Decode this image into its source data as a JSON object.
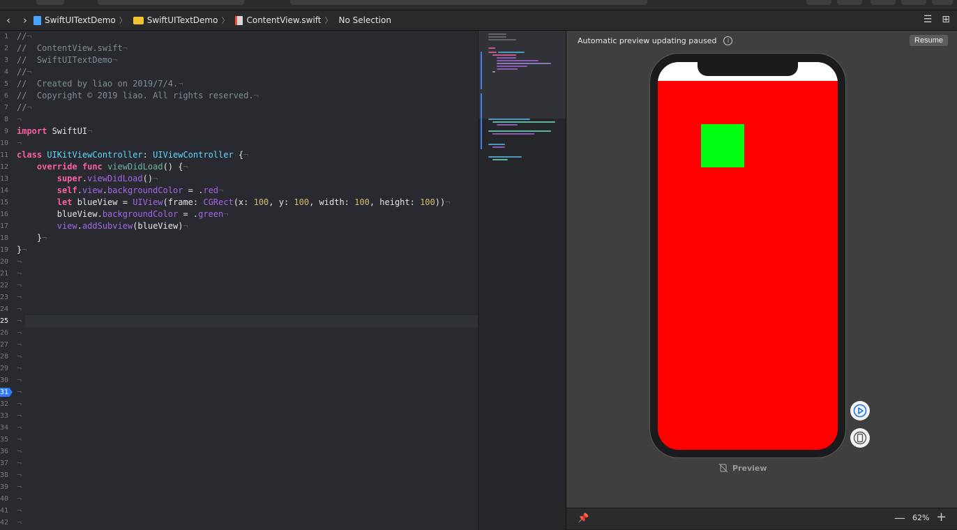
{
  "jumpbar": {
    "crumbs": [
      {
        "label": "SwiftUITextDemo",
        "icon": "swift-project-icon"
      },
      {
        "label": "SwiftUITextDemo",
        "icon": "folder-icon"
      },
      {
        "label": "ContentView.swift",
        "icon": "swift-file-icon"
      },
      {
        "label": "No Selection",
        "icon": ""
      }
    ]
  },
  "editor": {
    "current_line": 25,
    "breakpoint_line": 31,
    "line_count": 42
  },
  "code_lines": [
    [
      {
        "t": "//",
        "c": "com"
      },
      {
        "t": "¬",
        "c": "sp"
      }
    ],
    [
      {
        "t": "//  ContentView.swift",
        "c": "com"
      },
      {
        "t": "¬",
        "c": "sp"
      }
    ],
    [
      {
        "t": "//  SwiftUITextDemo",
        "c": "com"
      },
      {
        "t": "¬",
        "c": "sp"
      }
    ],
    [
      {
        "t": "//",
        "c": "com"
      },
      {
        "t": "¬",
        "c": "sp"
      }
    ],
    [
      {
        "t": "//  Created by liao on 2019/7/4.",
        "c": "com"
      },
      {
        "t": "¬",
        "c": "sp"
      }
    ],
    [
      {
        "t": "//  Copyright © 2019 liao. All rights reserved.",
        "c": "com"
      },
      {
        "t": "¬",
        "c": "sp"
      }
    ],
    [
      {
        "t": "//",
        "c": "com"
      },
      {
        "t": "¬",
        "c": "sp"
      }
    ],
    [
      {
        "t": "¬",
        "c": "sp"
      }
    ],
    [
      {
        "t": "import",
        "c": "kw"
      },
      {
        "t": " SwiftUI",
        "c": "plain"
      },
      {
        "t": "¬",
        "c": "sp"
      }
    ],
    [
      {
        "t": "¬",
        "c": "sp"
      }
    ],
    [
      {
        "t": "class",
        "c": "kw"
      },
      {
        "t": " ",
        "c": "plain"
      },
      {
        "t": "UIKitViewController",
        "c": "type"
      },
      {
        "t": ": ",
        "c": "plain"
      },
      {
        "t": "UIViewController",
        "c": "type"
      },
      {
        "t": " {",
        "c": "plain"
      },
      {
        "t": "¬",
        "c": "sp"
      }
    ],
    [
      {
        "t": "    ",
        "c": "plain"
      },
      {
        "t": "override",
        "c": "kw"
      },
      {
        "t": " ",
        "c": "plain"
      },
      {
        "t": "func",
        "c": "kw"
      },
      {
        "t": " ",
        "c": "plain"
      },
      {
        "t": "viewDidLoad",
        "c": "fn"
      },
      {
        "t": "() {",
        "c": "plain"
      },
      {
        "t": "¬",
        "c": "sp"
      }
    ],
    [
      {
        "t": "        ",
        "c": "plain"
      },
      {
        "t": "super",
        "c": "kw"
      },
      {
        "t": ".",
        "c": "plain"
      },
      {
        "t": "viewDidLoad",
        "c": "prop"
      },
      {
        "t": "()",
        "c": "plain"
      },
      {
        "t": "¬",
        "c": "sp"
      }
    ],
    [
      {
        "t": "        ",
        "c": "plain"
      },
      {
        "t": "self",
        "c": "kw"
      },
      {
        "t": ".",
        "c": "plain"
      },
      {
        "t": "view",
        "c": "prop"
      },
      {
        "t": ".",
        "c": "plain"
      },
      {
        "t": "backgroundColor",
        "c": "prop"
      },
      {
        "t": " = .",
        "c": "plain"
      },
      {
        "t": "red",
        "c": "prop"
      },
      {
        "t": "¬",
        "c": "sp"
      }
    ],
    [
      {
        "t": "        ",
        "c": "plain"
      },
      {
        "t": "let",
        "c": "kw"
      },
      {
        "t": " blueView = ",
        "c": "plain"
      },
      {
        "t": "UIView",
        "c": "prop"
      },
      {
        "t": "(frame: ",
        "c": "plain"
      },
      {
        "t": "CGRect",
        "c": "prop"
      },
      {
        "t": "(x: ",
        "c": "plain"
      },
      {
        "t": "100",
        "c": "num"
      },
      {
        "t": ", y: ",
        "c": "plain"
      },
      {
        "t": "100",
        "c": "num"
      },
      {
        "t": ", width: ",
        "c": "plain"
      },
      {
        "t": "100",
        "c": "num"
      },
      {
        "t": ", height: ",
        "c": "plain"
      },
      {
        "t": "100",
        "c": "num"
      },
      {
        "t": "))",
        "c": "plain"
      },
      {
        "t": "¬",
        "c": "sp"
      }
    ],
    [
      {
        "t": "        blueView.",
        "c": "plain"
      },
      {
        "t": "backgroundColor",
        "c": "prop"
      },
      {
        "t": " = .",
        "c": "plain"
      },
      {
        "t": "green",
        "c": "prop"
      },
      {
        "t": "¬",
        "c": "sp"
      }
    ],
    [
      {
        "t": "        ",
        "c": "plain"
      },
      {
        "t": "view",
        "c": "prop"
      },
      {
        "t": ".",
        "c": "plain"
      },
      {
        "t": "addSubview",
        "c": "prop"
      },
      {
        "t": "(blueView)",
        "c": "plain"
      },
      {
        "t": "¬",
        "c": "sp"
      }
    ],
    [
      {
        "t": "    }",
        "c": "plain"
      },
      {
        "t": "¬",
        "c": "sp"
      }
    ],
    [
      {
        "t": "}",
        "c": "plain"
      },
      {
        "t": "¬",
        "c": "sp"
      }
    ],
    [
      {
        "t": "¬",
        "c": "sp"
      }
    ],
    [
      {
        "t": "¬",
        "c": "sp"
      }
    ],
    [
      {
        "t": "¬",
        "c": "sp"
      }
    ],
    [
      {
        "t": "¬",
        "c": "sp"
      }
    ],
    [
      {
        "t": "¬",
        "c": "sp"
      }
    ],
    [
      {
        "t": "¬",
        "c": "sp"
      }
    ],
    [
      {
        "t": "¬",
        "c": "sp"
      }
    ],
    [
      {
        "t": "¬",
        "c": "sp"
      }
    ],
    [
      {
        "t": "¬",
        "c": "sp"
      }
    ],
    [
      {
        "t": "¬",
        "c": "sp"
      }
    ],
    [
      {
        "t": "¬",
        "c": "sp"
      }
    ],
    [
      {
        "t": "¬",
        "c": "sp"
      }
    ],
    [
      {
        "t": "¬",
        "c": "sp"
      }
    ],
    [
      {
        "t": "¬",
        "c": "sp"
      }
    ],
    [
      {
        "t": "¬",
        "c": "sp"
      }
    ],
    [
      {
        "t": "¬",
        "c": "sp"
      }
    ],
    [
      {
        "t": "¬",
        "c": "sp"
      }
    ],
    [
      {
        "t": "¬",
        "c": "sp"
      }
    ],
    [
      {
        "t": "¬",
        "c": "sp"
      }
    ],
    [
      {
        "t": "¬",
        "c": "sp"
      }
    ],
    [
      {
        "t": "¬",
        "c": "sp"
      }
    ],
    [
      {
        "t": "¬",
        "c": "sp"
      }
    ],
    [
      {
        "t": "¬",
        "c": "sp"
      }
    ]
  ],
  "preview": {
    "status": "Automatic preview updating paused",
    "resume_label": "Resume",
    "label": "Preview",
    "zoom": "62%",
    "screen_color": "#ff0000",
    "subview_color": "#00ff12"
  },
  "colors": {
    "editor_bg": "#292a30",
    "accent": "#2f7cf6"
  }
}
